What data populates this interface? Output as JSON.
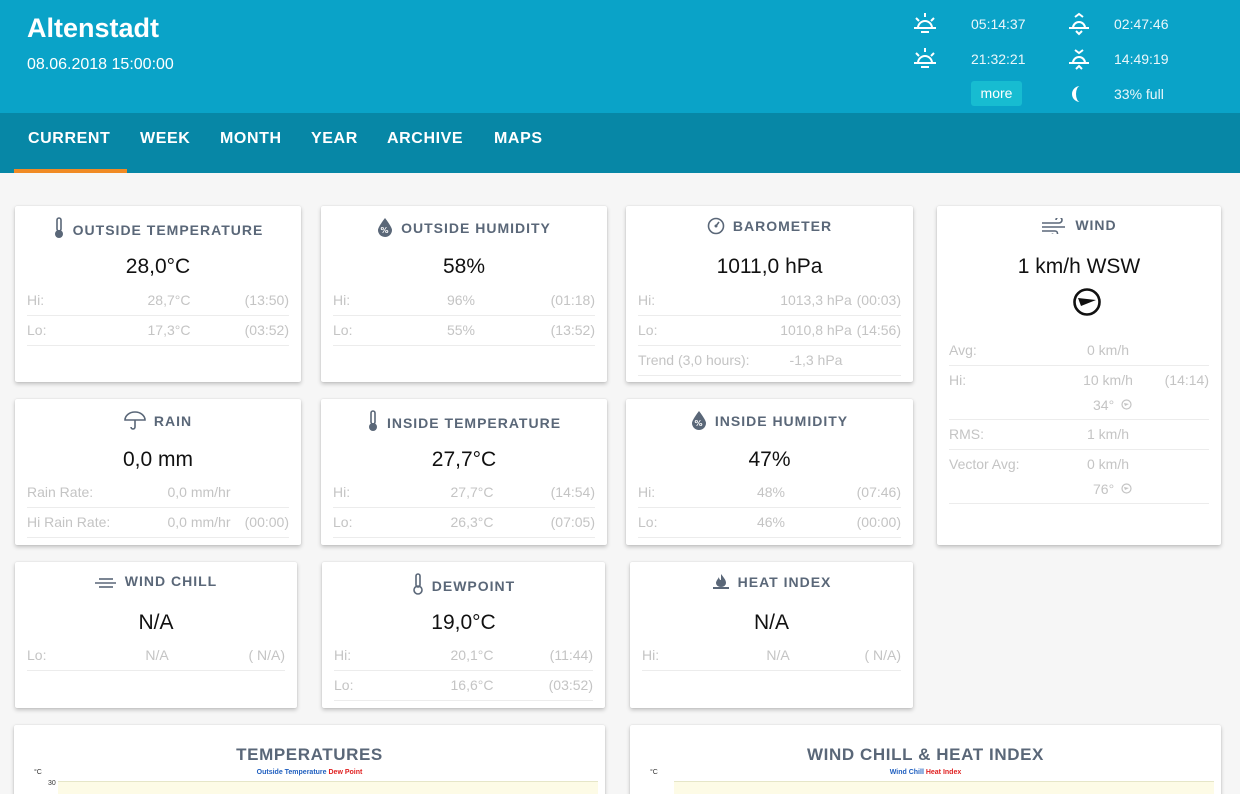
{
  "header": {
    "station": "Altenstadt",
    "datetime": "08.06.2018 15:00:00",
    "sunrise": "05:14:37",
    "sunset": "21:32:21",
    "moonrise": "02:47:46",
    "moonset": "14:49:19",
    "more_label": "more",
    "moon_phase": "33% full",
    "icons": [
      "sunrise-icon",
      "sunset-icon",
      "moonrise-icon",
      "moonset-icon",
      "moon-phase-icon"
    ]
  },
  "nav": {
    "items": [
      "CURRENT",
      "WEEK",
      "MONTH",
      "YEAR",
      "ARCHIVE",
      "MAPS"
    ],
    "active": "CURRENT",
    "accent": "#f08a24"
  },
  "cards": {
    "outside_temp": {
      "title": "OUTSIDE TEMPERATURE",
      "value": "28,0°C",
      "rows": [
        {
          "label": "Hi:",
          "value": "28,7°C",
          "time": "(13:50)"
        },
        {
          "label": "Lo:",
          "value": "17,3°C",
          "time": "(03:52)"
        }
      ]
    },
    "outside_humidity": {
      "title": "OUTSIDE HUMIDITY",
      "value": "58%",
      "rows": [
        {
          "label": "Hi:",
          "value": "96%",
          "time": "(01:18)"
        },
        {
          "label": "Lo:",
          "value": "55%",
          "time": "(13:52)"
        }
      ]
    },
    "barometer": {
      "title": "BAROMETER",
      "value": "1011,0 hPa",
      "rows": [
        {
          "label": "Hi:",
          "value": "1013,3 hPa",
          "time": "(00:03)"
        },
        {
          "label": "Lo:",
          "value": "1010,8 hPa",
          "time": "(14:56)"
        },
        {
          "label": "Trend (3,0 hours):",
          "value": "-1,3 hPa",
          "time": ""
        }
      ]
    },
    "wind": {
      "title": "WIND",
      "value": "1 km/h WSW",
      "rows": [
        {
          "label": "Avg:",
          "value": "0 km/h",
          "time": "",
          "sub": ""
        },
        {
          "label": "Hi:",
          "value": "10 km/h",
          "time": "(14:14)",
          "sub": "34°"
        },
        {
          "label": "RMS:",
          "value": "1 km/h",
          "time": "",
          "sub": ""
        },
        {
          "label": "Vector Avg:",
          "value": "0 km/h",
          "time": "",
          "sub": "76°"
        }
      ]
    },
    "rain": {
      "title": "RAIN",
      "value": "0,0 mm",
      "rows": [
        {
          "label": "Rain Rate:",
          "value": "0,0 mm/hr",
          "time": ""
        },
        {
          "label": "Hi Rain Rate:",
          "value": "0,0 mm/hr",
          "time": "(00:00)"
        }
      ]
    },
    "inside_temp": {
      "title": "INSIDE TEMPERATURE",
      "value": "27,7°C",
      "rows": [
        {
          "label": "Hi:",
          "value": "27,7°C",
          "time": "(14:54)"
        },
        {
          "label": "Lo:",
          "value": "26,3°C",
          "time": "(07:05)"
        }
      ]
    },
    "inside_humidity": {
      "title": "INSIDE HUMIDITY",
      "value": "47%",
      "rows": [
        {
          "label": "Hi:",
          "value": "48%",
          "time": "(07:46)"
        },
        {
          "label": "Lo:",
          "value": "46%",
          "time": "(00:00)"
        }
      ]
    },
    "wind_chill": {
      "title": "WIND CHILL",
      "value": "N/A",
      "rows": [
        {
          "label": "Lo:",
          "value": "N/A",
          "time": "( N/A)"
        }
      ]
    },
    "dewpoint": {
      "title": "DEWPOINT",
      "value": "19,0°C",
      "rows": [
        {
          "label": "Hi:",
          "value": "20,1°C",
          "time": "(11:44)"
        },
        {
          "label": "Lo:",
          "value": "16,6°C",
          "time": "(03:52)"
        }
      ]
    },
    "heat_index": {
      "title": "HEAT INDEX",
      "value": "N/A",
      "rows": [
        {
          "label": "Hi:",
          "value": "N/A",
          "time": "( N/A)"
        }
      ]
    }
  },
  "charts": {
    "temperatures": {
      "title": "TEMPERATURES",
      "legend": [
        "Outside Temperature",
        "Dew Point"
      ],
      "legend_colors": [
        "#1f5fbf",
        "#e02020"
      ],
      "unit": "°C",
      "tick": "30"
    },
    "chill_heat": {
      "title": "WIND CHILL & HEAT INDEX",
      "legend": [
        "Wind Chill",
        "Heat Index"
      ],
      "legend_colors": [
        "#1f5fbf",
        "#e02020"
      ],
      "unit": "°C"
    }
  }
}
